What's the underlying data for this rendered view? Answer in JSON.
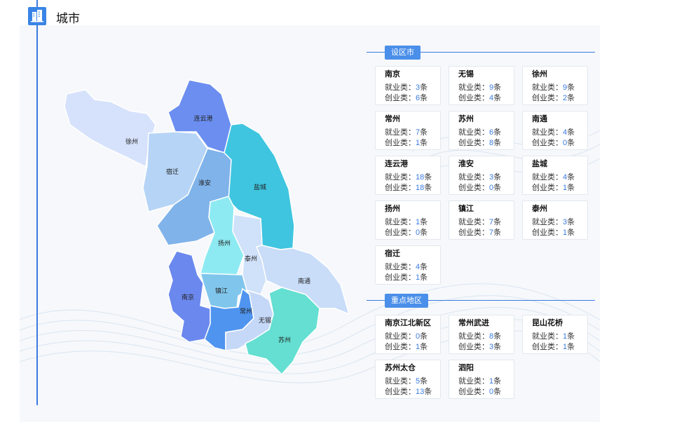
{
  "page": {
    "title": "城市"
  },
  "map": {
    "cities": [
      {
        "id": "xuzhou",
        "label": "徐州",
        "color": "#d6e2fb"
      },
      {
        "id": "lianyungang",
        "label": "连云港",
        "color": "#6b8ef0"
      },
      {
        "id": "suqian",
        "label": "宿迁",
        "color": "#b6d4f6"
      },
      {
        "id": "huaian",
        "label": "淮安",
        "color": "#7fb3ea"
      },
      {
        "id": "yancheng",
        "label": "盐城",
        "color": "#3fc5e0"
      },
      {
        "id": "yangzhou",
        "label": "扬州",
        "color": "#8eeaf2"
      },
      {
        "id": "taizhou",
        "label": "泰州",
        "color": "#d0e1fa"
      },
      {
        "id": "nantong",
        "label": "南通",
        "color": "#c9ddf9"
      },
      {
        "id": "nanjing",
        "label": "南京",
        "color": "#6b88ee"
      },
      {
        "id": "zhenjiang",
        "label": "镇江",
        "color": "#80c6ec"
      },
      {
        "id": "changzhou",
        "label": "常州",
        "color": "#4f94ee"
      },
      {
        "id": "wuxi",
        "label": "无锡",
        "color": "#c6d8f8"
      },
      {
        "id": "suzhou",
        "label": "苏州",
        "color": "#64dfd2"
      }
    ]
  },
  "sections": [
    {
      "title": "设区市",
      "cards": [
        {
          "name": "南京",
          "job_label": "就业类：",
          "job": "3",
          "start_label": "创业类：",
          "start": "6",
          "unit": "条"
        },
        {
          "name": "无锡",
          "job_label": "就业类：",
          "job": "9",
          "start_label": "创业类：",
          "start": "4",
          "unit": "条"
        },
        {
          "name": "徐州",
          "job_label": "就业类：",
          "job": "9",
          "start_label": "创业类：",
          "start": "2",
          "unit": "条"
        },
        {
          "name": "常州",
          "job_label": "就业类：",
          "job": "7",
          "start_label": "创业类：",
          "start": "1",
          "unit": "条"
        },
        {
          "name": "苏州",
          "job_label": "就业类：",
          "job": "6",
          "start_label": "创业类：",
          "start": "8",
          "unit": "条"
        },
        {
          "name": "南通",
          "job_label": "就业类：",
          "job": "4",
          "start_label": "创业类：",
          "start": "0",
          "unit": "条"
        },
        {
          "name": "连云港",
          "job_label": "就业类：",
          "job": "18",
          "start_label": "创业类：",
          "start": "18",
          "unit": "条"
        },
        {
          "name": "淮安",
          "job_label": "就业类：",
          "job": "3",
          "start_label": "创业类：",
          "start": "0",
          "unit": "条"
        },
        {
          "name": "盐城",
          "job_label": "就业类：",
          "job": "4",
          "start_label": "创业类：",
          "start": "1",
          "unit": "条"
        },
        {
          "name": "扬州",
          "job_label": "就业类：",
          "job": "1",
          "start_label": "创业类：",
          "start": "0",
          "unit": "条"
        },
        {
          "name": "镇江",
          "job_label": "就业类：",
          "job": "7",
          "start_label": "创业类：",
          "start": "7",
          "unit": "条"
        },
        {
          "name": "泰州",
          "job_label": "就业类：",
          "job": "3",
          "start_label": "创业类：",
          "start": "1",
          "unit": "条"
        },
        {
          "name": "宿迁",
          "job_label": "就业类：",
          "job": "4",
          "start_label": "创业类：",
          "start": "1",
          "unit": "条"
        }
      ]
    },
    {
      "title": "重点地区",
      "cards": [
        {
          "name": "南京江北新区",
          "job_label": "就业类：",
          "job": "0",
          "start_label": "创业类：",
          "start": "1",
          "unit": "条"
        },
        {
          "name": "常州武进",
          "job_label": "就业类：",
          "job": "8",
          "start_label": "创业类：",
          "start": "3",
          "unit": "条"
        },
        {
          "name": "昆山花桥",
          "job_label": "就业类：",
          "job": "1",
          "start_label": "创业类：",
          "start": "1",
          "unit": "条"
        },
        {
          "name": "苏州太仓",
          "job_label": "就业类：",
          "job": "5",
          "start_label": "创业类：",
          "start": "13",
          "unit": "条"
        },
        {
          "name": "泗阳",
          "job_label": "就业类：",
          "job": "1",
          "start_label": "创业类：",
          "start": "0",
          "unit": "条"
        }
      ]
    }
  ]
}
